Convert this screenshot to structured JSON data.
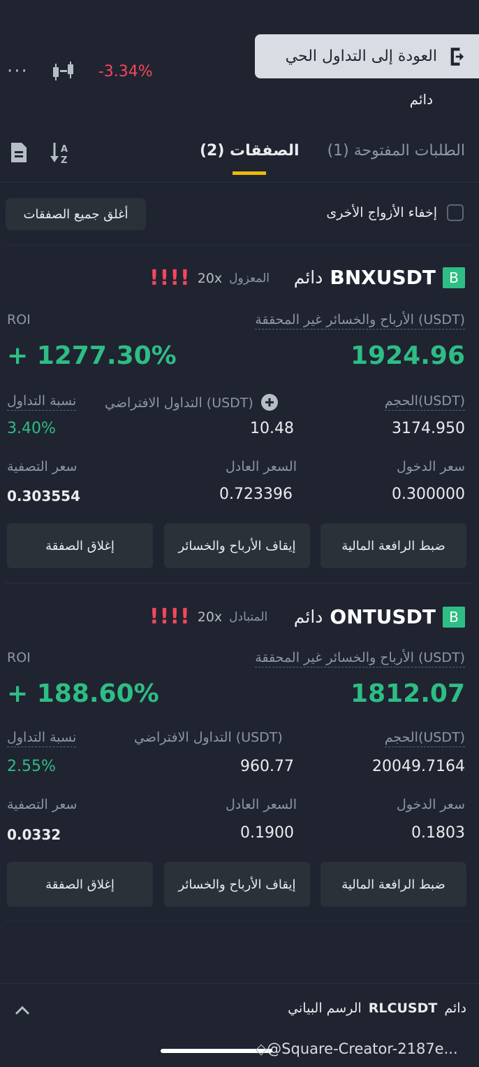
{
  "header": {
    "back_to_live": "العودة إلى التداول الحي",
    "symbol_partial": "RLCUSDT",
    "perpetual": "دائم",
    "change_pct": "-3.34%",
    "more": "···"
  },
  "tabs": {
    "positions": "الصفقات (2)",
    "open_orders": "الطلبات المفتوحة (1)"
  },
  "filters": {
    "hide_other_pairs": "إخفاء الأزواج الأخرى",
    "close_all": "أغلق جميع الصفقات"
  },
  "positions": [
    {
      "badge": "B",
      "symbol": "BNXUSDT",
      "perpetual": "دائم",
      "margin_mode": "المعزول",
      "leverage": "20x",
      "warning": "!!!!",
      "pnl_label": "الأرباح والخسائر غير المحققة (USDT)",
      "pnl_value": "1924.96",
      "roi_label": "ROI",
      "roi_value": "+ 1277.30%",
      "size_label": "الحجم(USDT)",
      "size_value": "3174.950",
      "virtual_label": "التداول الافتراضي (USDT)",
      "virtual_value": "10.48",
      "ratio_label": "نسبة التداول",
      "ratio_value": "3.40%",
      "entry_label": "سعر الدخول",
      "entry_value": "0.300000",
      "mark_label": "السعر العادل",
      "mark_value": "0.723396",
      "liq_label": "سعر التصفية",
      "liq_value": "0.303554",
      "btn_leverage": "ضبط الرافعة المالية",
      "btn_tpsl": "إيقاف الأرباح والخسائر",
      "btn_close": "إغلاق الصفقة"
    },
    {
      "badge": "B",
      "symbol": "ONTUSDT",
      "perpetual": "دائم",
      "margin_mode": "المتبادل",
      "leverage": "20x",
      "warning": "!!!!",
      "pnl_label": "الأرباح والخسائر غير المحققة (USDT)",
      "pnl_value": "1812.07",
      "roi_label": "ROI",
      "roi_value": "+ 188.60%",
      "size_label": "الحجم(USDT)",
      "size_value": "20049.7164",
      "virtual_label": "التداول الافتراضي (USDT)",
      "virtual_value": "960.77",
      "ratio_label": "نسبة التداول",
      "ratio_value": "2.55%",
      "entry_label": "سعر الدخول",
      "entry_value": "0.1803",
      "mark_label": "السعر العادل",
      "mark_value": "0.1900",
      "liq_label": "سعر التصفية",
      "liq_value": "0.0332",
      "btn_leverage": "ضبط الرافعة المالية",
      "btn_tpsl": "إيقاف الأرباح والخسائر",
      "btn_close": "إغلاق الصفقة"
    }
  ],
  "bottom": {
    "perpetual": "دائم",
    "symbol": "RLCUSDT",
    "chart_label": "الرسم البياني"
  },
  "watermark": "@Square-Creator-2187e..."
}
